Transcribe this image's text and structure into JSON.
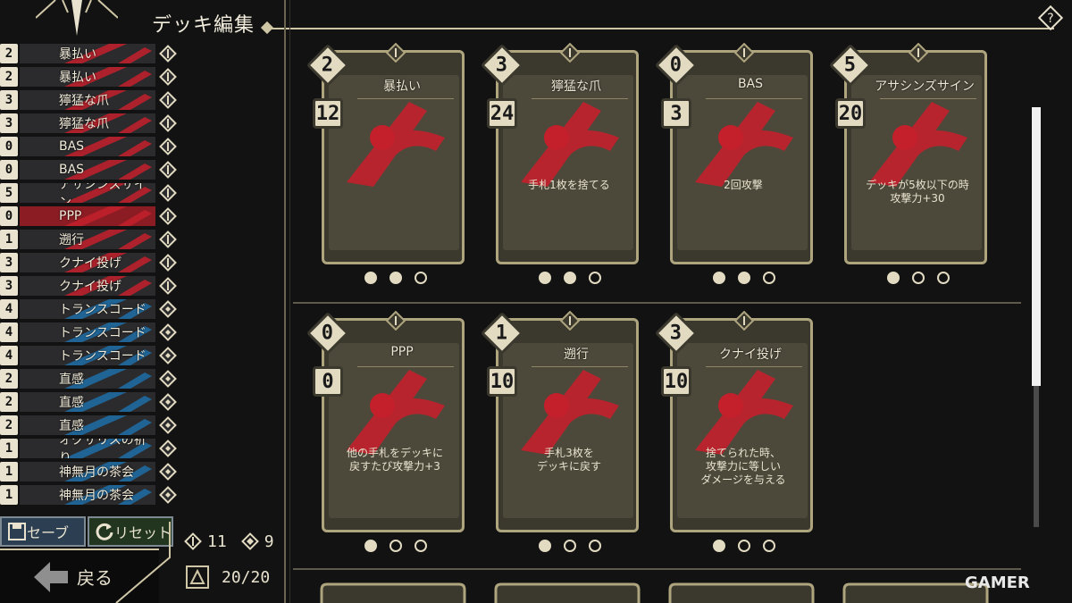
{
  "header": {
    "title": "デッキ編集",
    "help_icon": "question-diamond-icon"
  },
  "deck": [
    {
      "cost": "2",
      "name": "暴払い",
      "color": "red"
    },
    {
      "cost": "2",
      "name": "暴払い",
      "color": "red"
    },
    {
      "cost": "3",
      "name": "獰猛な爪",
      "color": "red"
    },
    {
      "cost": "3",
      "name": "獰猛な爪",
      "color": "red"
    },
    {
      "cost": "0",
      "name": "BAS",
      "color": "red"
    },
    {
      "cost": "0",
      "name": "BAS",
      "color": "red"
    },
    {
      "cost": "5",
      "name": "アサシンズサイン",
      "color": "red"
    },
    {
      "cost": "0",
      "name": "PPP",
      "color": "red",
      "selected": true
    },
    {
      "cost": "1",
      "name": "遡行",
      "color": "red"
    },
    {
      "cost": "3",
      "name": "クナイ投げ",
      "color": "red"
    },
    {
      "cost": "3",
      "name": "クナイ投げ",
      "color": "red"
    },
    {
      "cost": "4",
      "name": "トランスコード",
      "color": "blue"
    },
    {
      "cost": "4",
      "name": "トランスコード",
      "color": "blue"
    },
    {
      "cost": "4",
      "name": "トランスコード",
      "color": "blue"
    },
    {
      "cost": "2",
      "name": "直感",
      "color": "blue"
    },
    {
      "cost": "2",
      "name": "直感",
      "color": "blue"
    },
    {
      "cost": "2",
      "name": "直感",
      "color": "blue"
    },
    {
      "cost": "1",
      "name": "オクサリスの祈り",
      "color": "blue"
    },
    {
      "cost": "1",
      "name": "神無月の茶会",
      "color": "blue"
    },
    {
      "cost": "1",
      "name": "神無月の茶会",
      "color": "blue"
    }
  ],
  "buttons": {
    "save": "セーブ",
    "reset": "リセット",
    "back": "戻る"
  },
  "stats": {
    "red_count": "11",
    "blue_count": "9",
    "deck_size": "20/20"
  },
  "cards": [
    {
      "cost": "2",
      "attack": "12",
      "name": "暴払い",
      "desc": "",
      "dots": [
        1,
        1,
        0
      ]
    },
    {
      "cost": "3",
      "attack": "24",
      "name": "獰猛な爪",
      "desc": "手札1枚を捨てる",
      "dots": [
        1,
        1,
        0
      ]
    },
    {
      "cost": "0",
      "attack": "3",
      "name": "BAS",
      "desc": "2回攻撃",
      "dots": [
        1,
        1,
        0
      ]
    },
    {
      "cost": "5",
      "attack": "20",
      "name": "アサシンズサイン",
      "desc": "デッキが5枚以下の時\n攻撃力+30",
      "dots": [
        1,
        0,
        0
      ]
    },
    {
      "cost": "0",
      "attack": "0",
      "name": "PPP",
      "desc": "他の手札をデッキに\n戻すたび攻撃力+3",
      "dots": [
        1,
        0,
        0
      ]
    },
    {
      "cost": "1",
      "attack": "10",
      "name": "遡行",
      "desc": "手札3枚を\nデッキに戻す",
      "dots": [
        1,
        0,
        0
      ]
    },
    {
      "cost": "3",
      "attack": "10",
      "name": "クナイ投げ",
      "desc": "捨てられた時、\n攻撃力に等しい\nダメージを与える",
      "dots": [
        1,
        0,
        0
      ]
    }
  ],
  "colors": {
    "red": "#c3202c",
    "blue": "#1f6fa8",
    "gold": "#aea57f",
    "cream": "#e2dbc2"
  },
  "watermark": "GAMER"
}
